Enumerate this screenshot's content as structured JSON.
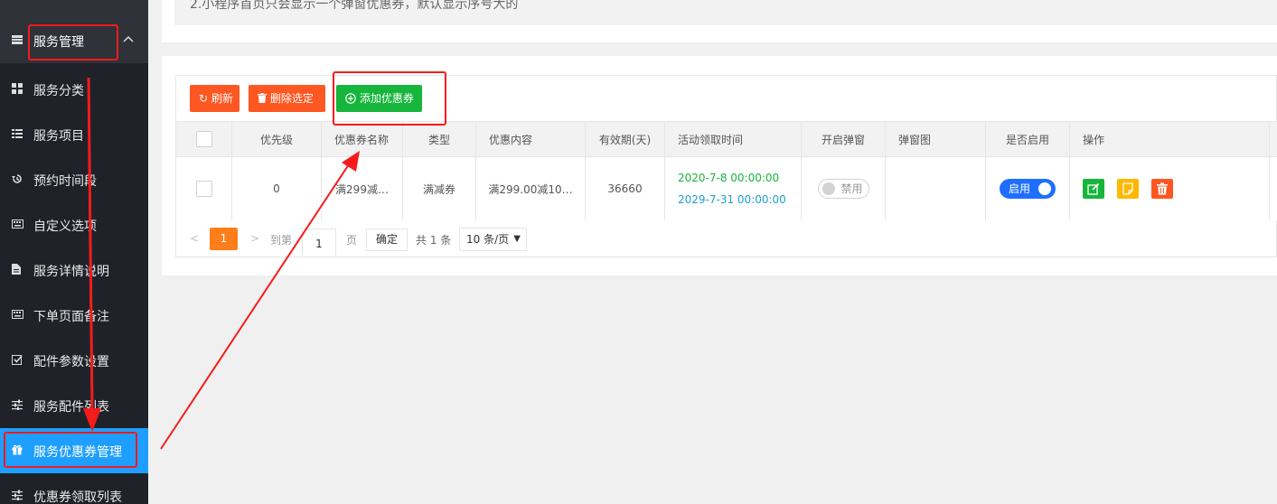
{
  "notice": {
    "text": "2.小程序首页只会显示一个弹窗优惠券，默认显示序号大的"
  },
  "sidebar": {
    "parent": {
      "label": "服务管理",
      "icon": "list-icon",
      "chevron": "^"
    },
    "items": [
      {
        "label": "服务分类",
        "icon": "grid-icon"
      },
      {
        "label": "服务项目",
        "icon": "list-icon"
      },
      {
        "label": "预约时间段",
        "icon": "history-icon"
      },
      {
        "label": "自定义选项",
        "icon": "keyboard-icon"
      },
      {
        "label": "服务详情说明",
        "icon": "document-icon"
      },
      {
        "label": "下单页面备注",
        "icon": "keyboard-icon"
      },
      {
        "label": "配件参数设置",
        "icon": "checkbox-icon"
      },
      {
        "label": "服务配件列表",
        "icon": "sliders-icon"
      },
      {
        "label": "服务优惠券管理",
        "icon": "gift-icon",
        "active": true
      },
      {
        "label": "优惠券领取列表",
        "icon": "sliders-icon"
      }
    ]
  },
  "toolbar": {
    "refresh": {
      "icon": "refresh-icon",
      "label": "刷新"
    },
    "delete": {
      "icon": "trash-icon",
      "label": "删除选定"
    },
    "add": {
      "icon": "plus-circle-icon",
      "label": "添加优惠券"
    }
  },
  "table": {
    "headers": [
      "优先级",
      "优惠券名称",
      "类型",
      "优惠内容",
      "有效期(天)",
      "活动领取时间",
      "开启弹窗",
      "弹窗图",
      "是否启用",
      "操作"
    ],
    "rows": [
      {
        "priority": "0",
        "name": "满299减…",
        "type": "满减券",
        "content": "满299.00减10…",
        "validity": "36660",
        "start": "2020-7-8 00:00:00",
        "end": "2029-7-31 00:00:00",
        "popup_label": "禁用",
        "popup_image": "",
        "enabled_label": "启用",
        "actions": [
          "edit-icon",
          "note-icon",
          "delete-icon"
        ]
      }
    ]
  },
  "pagination": {
    "prev": "<",
    "current": "1",
    "next": ">",
    "goto_label": "到第",
    "page_input": "1",
    "page_unit": "页",
    "confirm": "确定",
    "total": "共 1 条",
    "page_size": "10 条/页"
  },
  "colors": {
    "sidebar_bg": "#20222a",
    "active_bg": "#1e9fff",
    "danger": "#ff5722",
    "success": "#16b53c",
    "warm": "#ff7e1b",
    "annotation": "#f51b1b"
  }
}
